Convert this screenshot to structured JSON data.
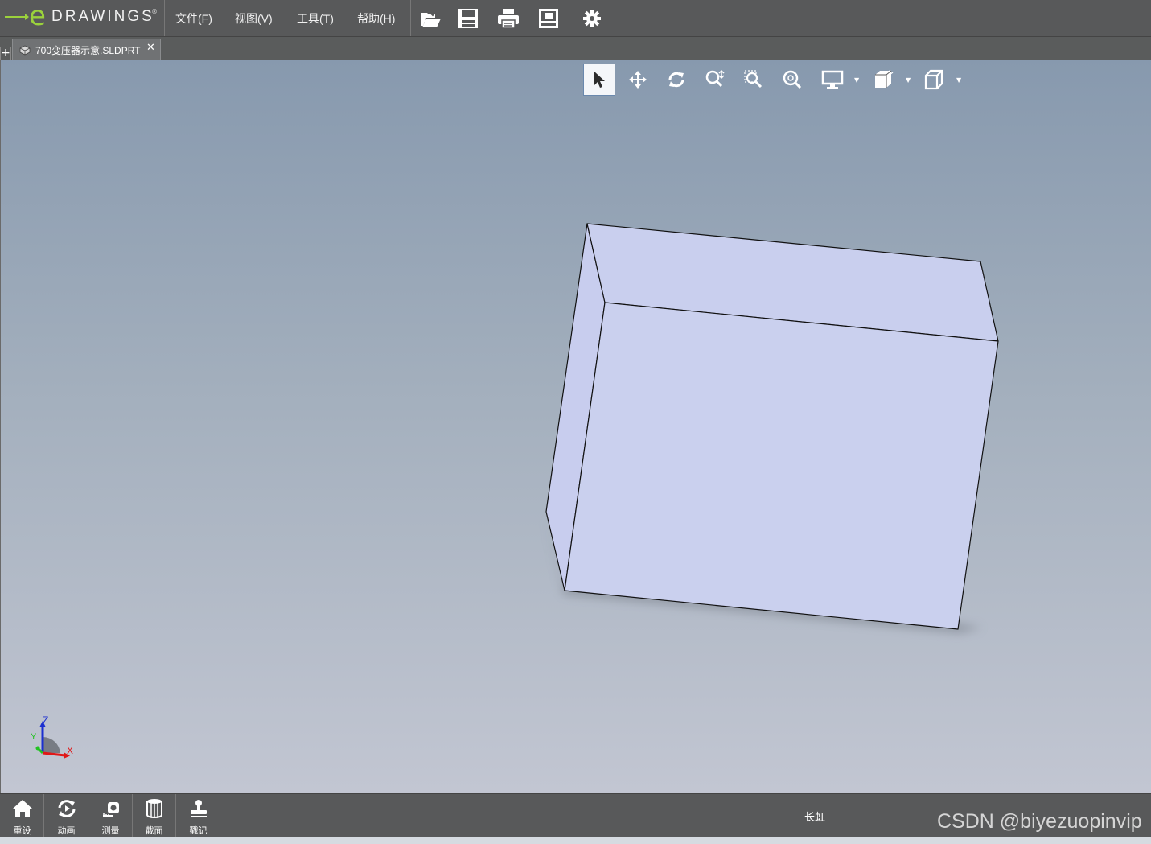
{
  "app": {
    "logo_text": "DRAWINGS",
    "logo_letter": "e",
    "logo_reg": "®"
  },
  "menu": [
    {
      "label": "文件(F)"
    },
    {
      "label": "视图(V)"
    },
    {
      "label": "工具(T)"
    },
    {
      "label": "帮助(H)"
    }
  ],
  "toolbar_icons": [
    "open-icon",
    "save-icon",
    "print-icon",
    "sheet-icon",
    "settings-icon"
  ],
  "tab": {
    "add_label": "+",
    "title": "700变压器示意.SLDPRT",
    "close_label": "✕"
  },
  "view_toolbar": {
    "active_tool": "select",
    "icons": [
      "select-icon",
      "pan-icon",
      "rotate-icon",
      "zoom-icon",
      "zoom-to-area-icon",
      "zoom-to-fit-icon",
      "display-style-icon",
      "shading-icon",
      "view-orientation-icon"
    ]
  },
  "triad": {
    "z_label": "Z",
    "x_label": "X",
    "y_label": "Y"
  },
  "bottom_bar": {
    "buttons": [
      {
        "label": "重设",
        "icon": "home-icon"
      },
      {
        "label": "动画",
        "icon": "animate-icon"
      },
      {
        "label": "测量",
        "icon": "measure-icon"
      },
      {
        "label": "截面",
        "icon": "section-icon"
      },
      {
        "label": "戳记",
        "icon": "stamp-icon"
      }
    ],
    "config_name": "长虹"
  },
  "watermark": "CSDN @biyezuopinvip",
  "colors": {
    "accent": "#9bd23c",
    "model_face": "#cad0ee",
    "toolbar_bg": "#58595a"
  }
}
